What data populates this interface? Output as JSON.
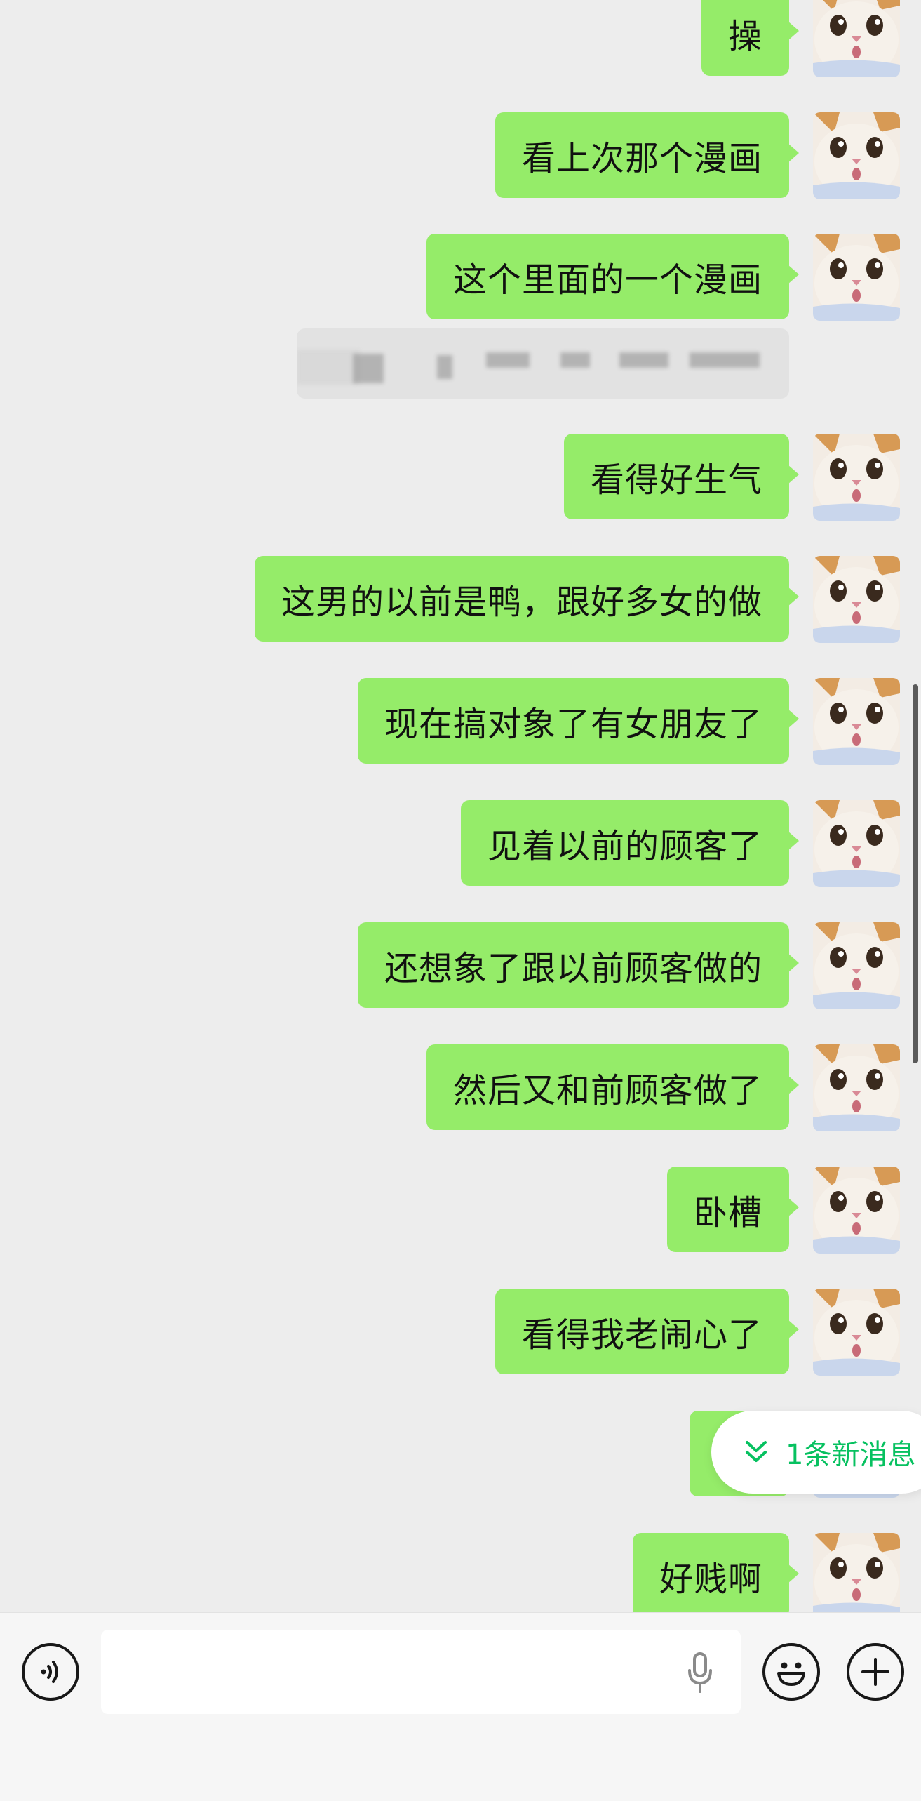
{
  "messages": [
    {
      "text": "操"
    },
    {
      "text": "看上次那个漫画"
    },
    {
      "text": "这个里面的一个漫画"
    },
    {
      "text": "看得好生气"
    },
    {
      "text": "这男的以前是鸭，跟好多女的做"
    },
    {
      "text": "现在搞对象了有女朋友了"
    },
    {
      "text": "见着以前的顾客了"
    },
    {
      "text": "还想象了跟以前顾客做的"
    },
    {
      "text": "然后又和前顾客做了"
    },
    {
      "text": "卧槽"
    },
    {
      "text": "看得我老闹心了"
    },
    {
      "text": ""
    },
    {
      "text": "好贱啊"
    }
  ],
  "link_card": {
    "content": "pixelated link (redacted)"
  },
  "new_message_pill": {
    "label": "1条新消息",
    "icon": "double-chevron-down-icon",
    "color": "#07c160"
  },
  "input_bar": {
    "voice_icon": "voice-toggle-icon",
    "mic_icon": "microphone-icon",
    "emoji_icon": "emoji-icon",
    "more_icon": "plus-icon",
    "input_value": ""
  },
  "colors": {
    "bubble": "#95ec69",
    "background": "#ededed",
    "accent": "#07c160"
  }
}
